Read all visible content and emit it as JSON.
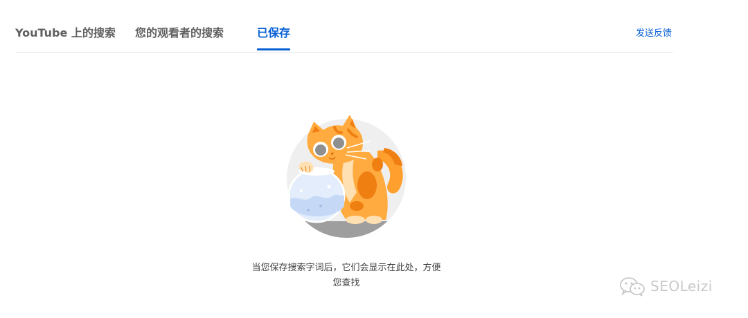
{
  "tabs": [
    {
      "label": "YouTube 上的搜索",
      "active": false
    },
    {
      "label": "您的观看者的搜索",
      "active": false
    },
    {
      "label": "已保存",
      "active": true
    }
  ],
  "feedback_label": "发送反馈",
  "empty_state": {
    "illustration": "cat-with-fishbowl",
    "line1": "当您保存搜索字词后，它们会显示在此处，方便",
    "line2": "您查找"
  },
  "watermark": {
    "icon": "wechat-icon",
    "text": "SEOLeizi"
  },
  "colors": {
    "accent": "#065fd4",
    "tab_inactive": "#606060",
    "divider": "#e5e5e5",
    "body_text": "#404040"
  }
}
